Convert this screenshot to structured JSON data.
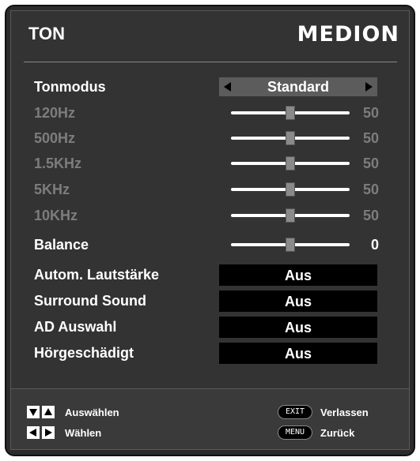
{
  "header": {
    "title": "TON",
    "brand": "MEDION"
  },
  "tonmodus": {
    "label": "Tonmodus",
    "value": "Standard"
  },
  "equalizer": [
    {
      "label": "120Hz",
      "value": "50",
      "level": 50
    },
    {
      "label": "500Hz",
      "value": "50",
      "level": 50
    },
    {
      "label": "1.5KHz",
      "value": "50",
      "level": 50
    },
    {
      "label": "5KHz",
      "value": "50",
      "level": 50
    },
    {
      "label": "10KHz",
      "value": "50",
      "level": 50
    }
  ],
  "balance": {
    "label": "Balance",
    "value": "0",
    "level": 50
  },
  "options": [
    {
      "label": "Autom. Lautstärke",
      "value": "Aus"
    },
    {
      "label": "Surround Sound",
      "value": "Aus"
    },
    {
      "label": "AD Auswahl",
      "value": "Aus"
    },
    {
      "label": "Hörgeschädigt",
      "value": "Aus"
    }
  ],
  "footer": {
    "select_label": "Auswählen",
    "change_label": "Wählen",
    "exit_key": "EXIT",
    "exit_label": "Verlassen",
    "menu_key": "MENU",
    "menu_label": "Zurück"
  },
  "colors": {
    "panel_bg": "#333333",
    "text_active": "#ffffff",
    "text_inactive": "#7d7d7d",
    "value_box_bg": "#000000"
  }
}
